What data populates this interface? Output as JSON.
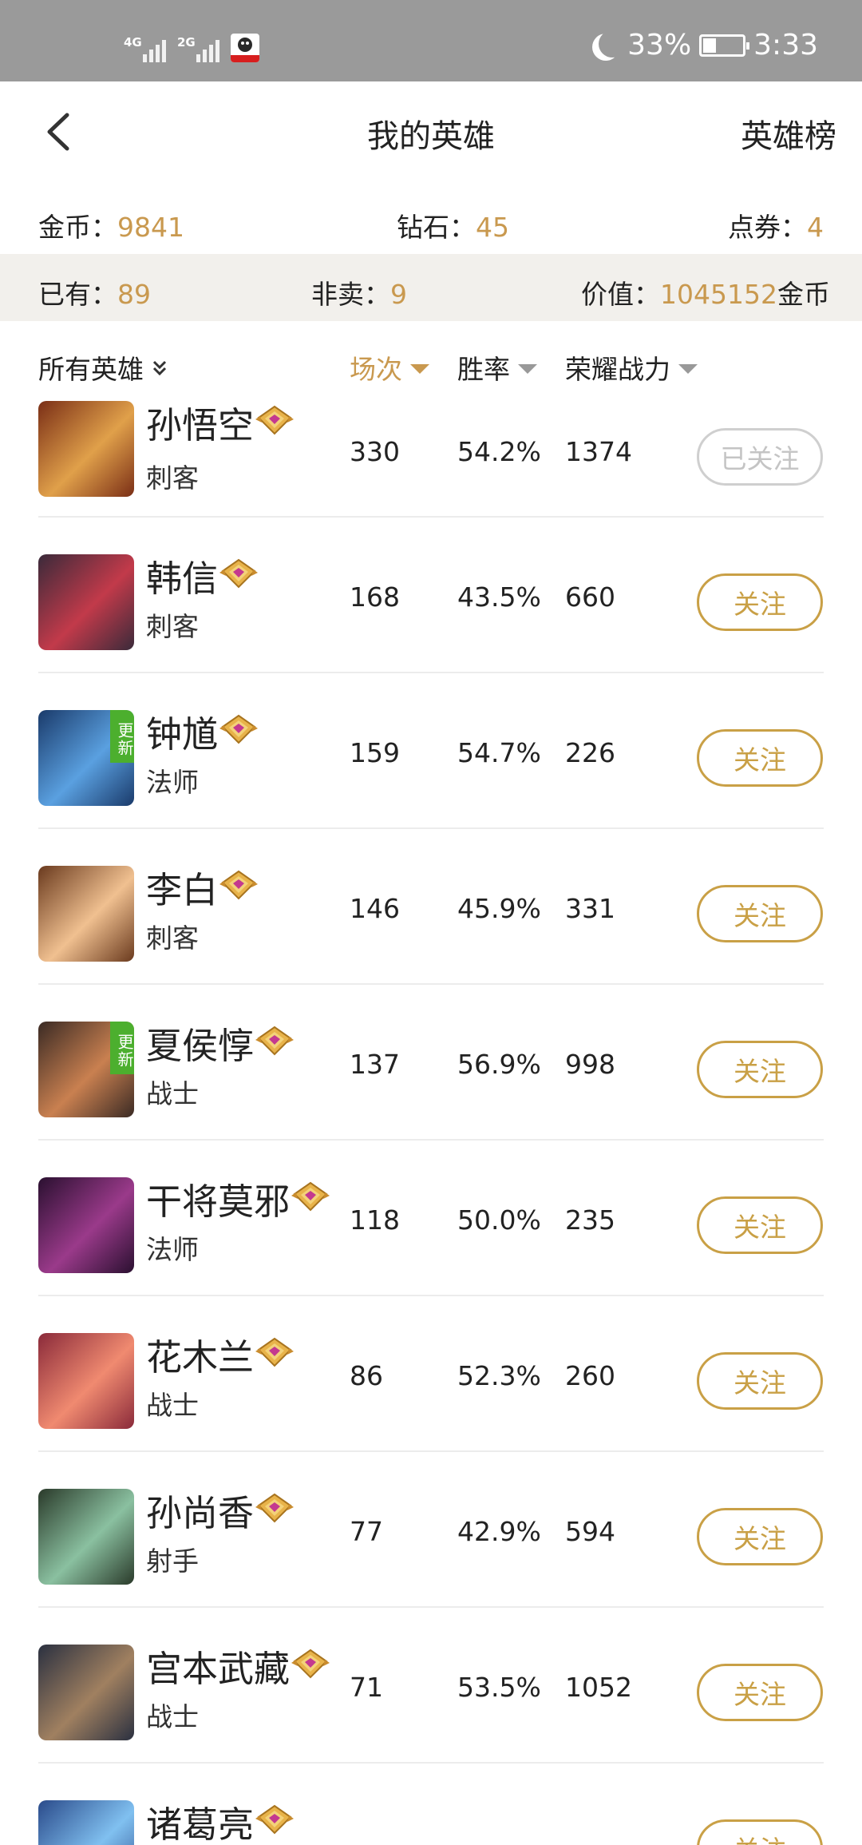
{
  "status_bar": {
    "signal1_label": "4G",
    "signal2_label": "2G",
    "battery": "33%",
    "time": "3:33",
    "icons": [
      "signal-icon",
      "signal-icon",
      "app-notification-icon",
      "moon-icon",
      "battery-icon"
    ]
  },
  "nav": {
    "title": "我的英雄",
    "right_link": "英雄榜",
    "back_icon": "back-arrow-icon"
  },
  "currency": {
    "gold_label": "金币：",
    "gold_value": "9841",
    "diamond_label": "钻石：",
    "diamond_value": "45",
    "voucher_label": "点券：",
    "voucher_value": "4"
  },
  "summary": {
    "owned_label": "已有：",
    "owned_value": "89",
    "notforsale_label": "非卖：",
    "notforsale_value": "9",
    "worth_label": "价值：",
    "worth_value": "1045152",
    "worth_unit": "金币"
  },
  "columns": {
    "filter_label": "所有英雄",
    "matches_label": "场次",
    "winrate_label": "胜率",
    "power_label": "荣耀战力",
    "active_sort": "matches"
  },
  "colors": {
    "accent": "#c9994f",
    "follow_border": "#c9a046",
    "statusbar": "#9a9a9a",
    "summary_bg": "#f2f0ec",
    "new_ribbon": "#4caf2e"
  },
  "heroes": [
    {
      "name": "孙悟空",
      "role": "刺客",
      "matches": "330",
      "winrate": "54.2%",
      "power": "1374",
      "button": "已关注",
      "followed": true,
      "new": false
    },
    {
      "name": "韩信",
      "role": "刺客",
      "matches": "168",
      "winrate": "43.5%",
      "power": "660",
      "button": "关注",
      "followed": false,
      "new": false
    },
    {
      "name": "钟馗",
      "role": "法师",
      "matches": "159",
      "winrate": "54.7%",
      "power": "226",
      "button": "关注",
      "followed": false,
      "new": true
    },
    {
      "name": "李白",
      "role": "刺客",
      "matches": "146",
      "winrate": "45.9%",
      "power": "331",
      "button": "关注",
      "followed": false,
      "new": false
    },
    {
      "name": "夏侯惇",
      "role": "战士",
      "matches": "137",
      "winrate": "56.9%",
      "power": "998",
      "button": "关注",
      "followed": false,
      "new": true
    },
    {
      "name": "干将莫邪",
      "role": "法师",
      "matches": "118",
      "winrate": "50.0%",
      "power": "235",
      "button": "关注",
      "followed": false,
      "new": false
    },
    {
      "name": "花木兰",
      "role": "战士",
      "matches": "86",
      "winrate": "52.3%",
      "power": "260",
      "button": "关注",
      "followed": false,
      "new": false
    },
    {
      "name": "孙尚香",
      "role": "射手",
      "matches": "77",
      "winrate": "42.9%",
      "power": "594",
      "button": "关注",
      "followed": false,
      "new": false
    },
    {
      "name": "宫本武藏",
      "role": "战士",
      "matches": "71",
      "winrate": "53.5%",
      "power": "1052",
      "button": "关注",
      "followed": false,
      "new": false
    },
    {
      "name": "诸葛亮",
      "role": "",
      "matches": "",
      "winrate": "",
      "power": "",
      "button": "关注",
      "followed": false,
      "new": false
    }
  ],
  "new_badge_text": "更新"
}
